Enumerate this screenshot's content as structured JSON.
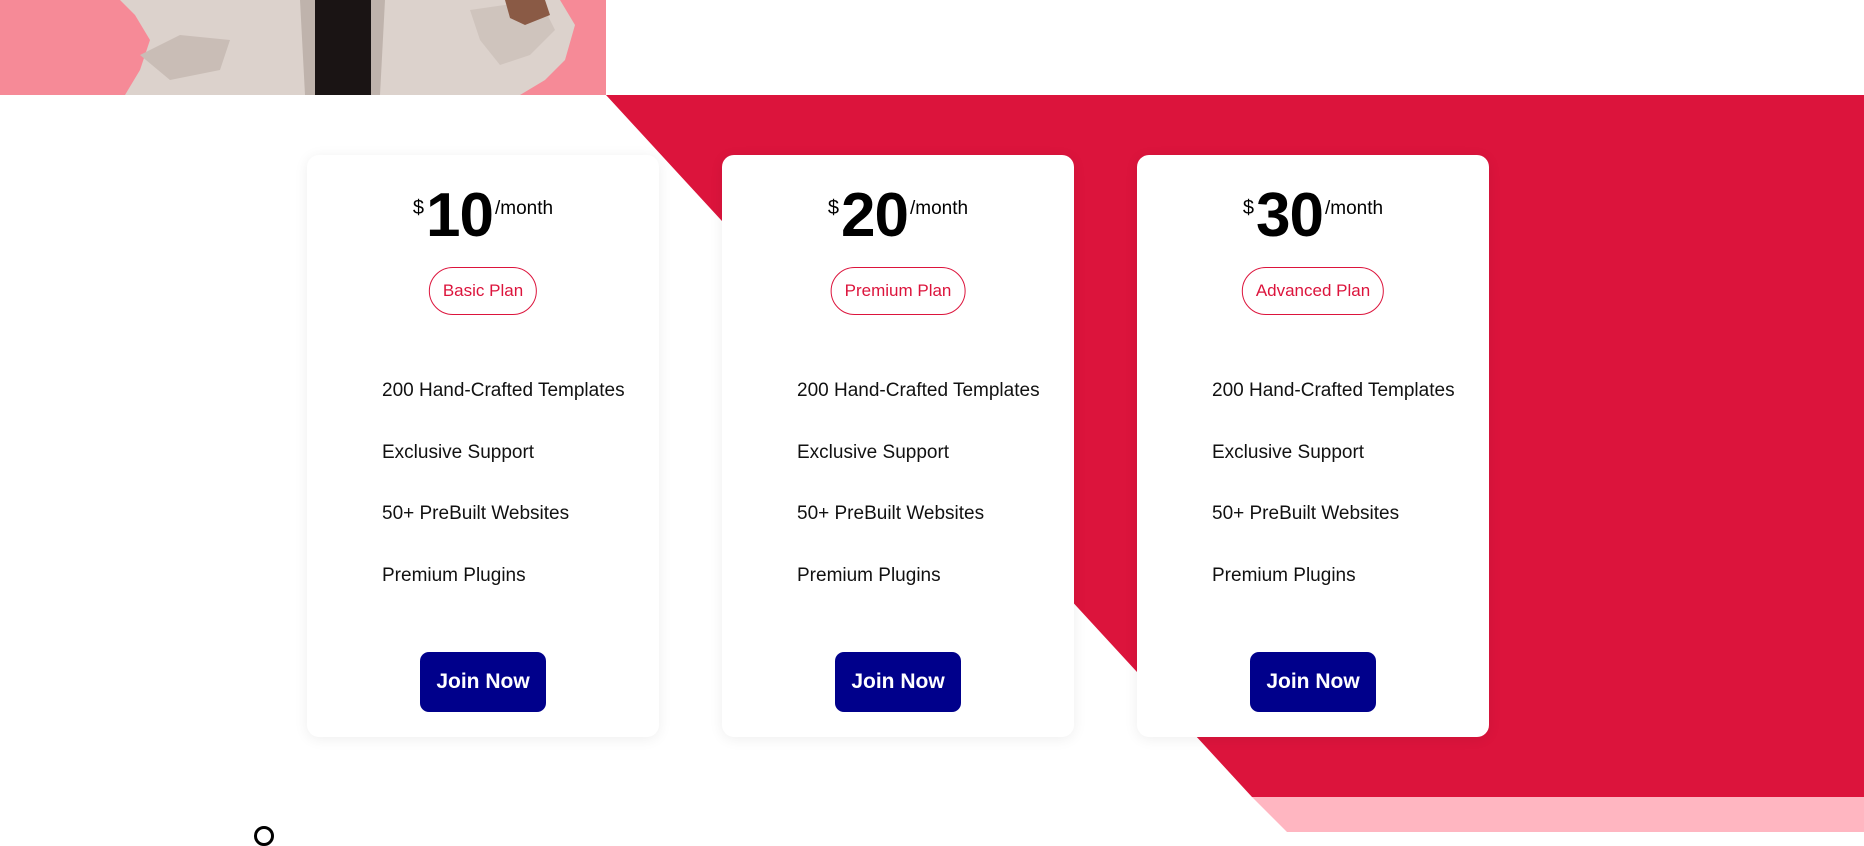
{
  "colors": {
    "accent_red": "#dc143c",
    "light_pink": "#ffb6c1",
    "button_navy": "#00008b",
    "photo_pink": "#f68a97"
  },
  "plans": [
    {
      "currency": "$",
      "amount": "10",
      "period": "/month",
      "name": "Basic Plan",
      "features": [
        "200 Hand-Crafted Templates",
        "Exclusive Support",
        "50+ PreBuilt Websites",
        "Premium Plugins"
      ],
      "cta": "Join Now"
    },
    {
      "currency": "$",
      "amount": "20",
      "period": "/month",
      "name": "Premium Plan",
      "features": [
        "200 Hand-Crafted Templates",
        "Exclusive Support",
        "50+ PreBuilt Websites",
        "Premium Plugins"
      ],
      "cta": "Join Now"
    },
    {
      "currency": "$",
      "amount": "30",
      "period": "/month",
      "name": "Advanced Plan",
      "features": [
        "200 Hand-Crafted Templates",
        "Exclusive Support",
        "50+ PreBuilt Websites",
        "Premium Plugins"
      ],
      "cta": "Join Now"
    }
  ]
}
